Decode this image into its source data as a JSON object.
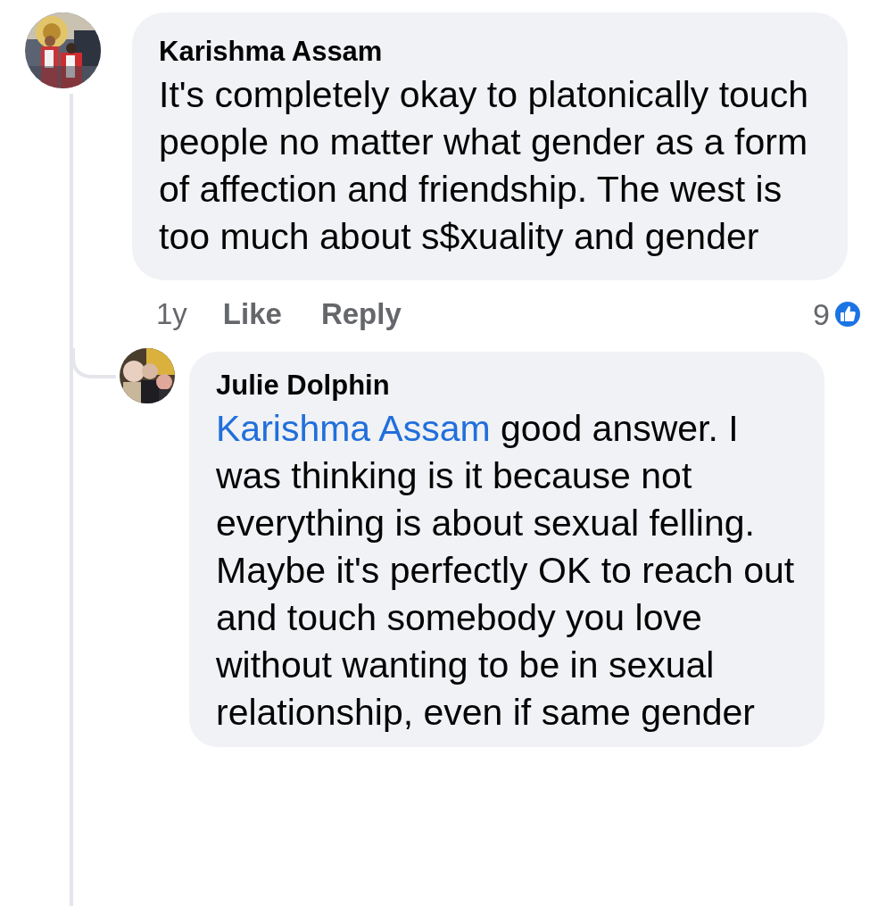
{
  "comment": {
    "author": "Karishma Assam",
    "text": "It's completely okay to platonically touch people no matter what gender as a form of affection and friendship. The west is too much about s$xuality and gender",
    "time": "1y",
    "actions": [
      "Like",
      "Reply"
    ],
    "reaction_count": "9",
    "reply": {
      "author": "Julie Dolphin",
      "mention": "Karishma Assam",
      "text": " good answer.  I was thinking is it because not everything is about sexual felling.  Maybe it's perfectly OK to reach out and touch somebody you love without wanting to be in sexual relationship, even if same gender"
    }
  }
}
